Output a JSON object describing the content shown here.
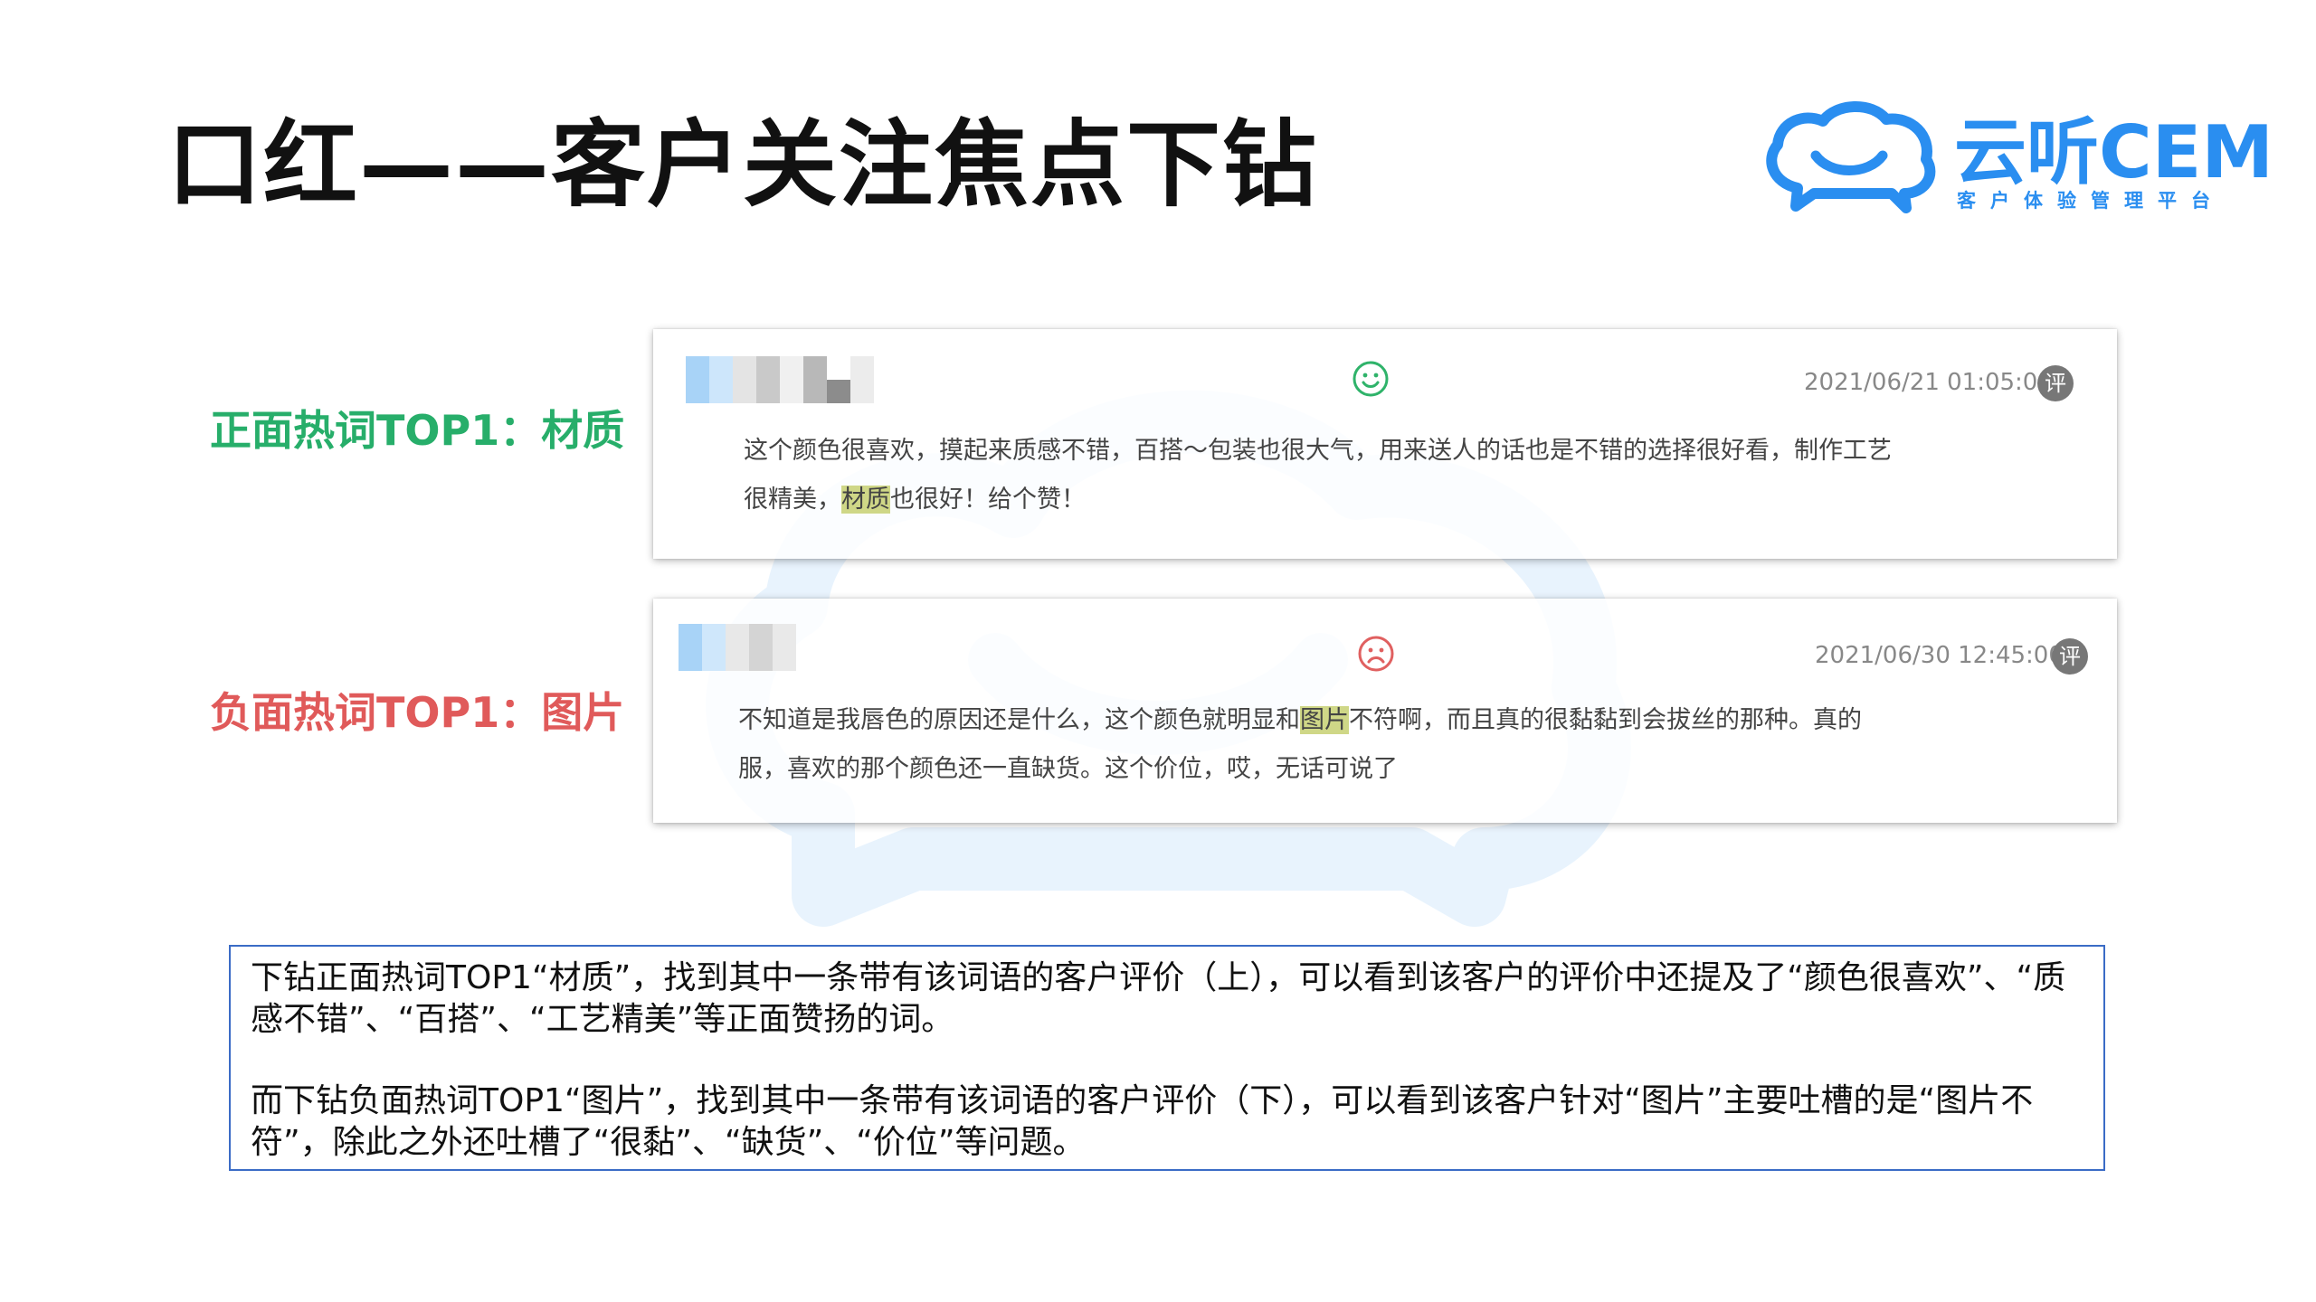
{
  "slide": {
    "title": "口红——客户关注焦点下钻"
  },
  "logo": {
    "name": "云听CEM",
    "subtitle": "客户体验管理平台",
    "icon": "cloud-chat-icon",
    "color": "#2a8ef0"
  },
  "labels": {
    "positive": "正面热词TOP1：材质",
    "negative": "负面热词TOP1：图片"
  },
  "reviews": [
    {
      "sentiment": "positive",
      "icon": "smile-face-icon",
      "timestamp": "2021/06/21 01:05:00",
      "badge": "评",
      "line1": "这个颜色很喜欢，摸起来质感不错，百搭～包装也很大气，用来送人的话也是不错的选择很好看，制作工艺",
      "line2_before": "很精美，",
      "keyword": "材质",
      "line2_after": "也很好！给个赞！"
    },
    {
      "sentiment": "negative",
      "icon": "sad-face-icon",
      "timestamp": "2021/06/30 12:45:00",
      "badge": "评",
      "line1_before": "不知道是我唇色的原因还是什么，这个颜色就明显和",
      "keyword": "图片",
      "line1_after": "不符啊，而且真的很黏黏到会拔丝的那种。真的",
      "line2": "服，喜欢的那个颜色还一直缺货。这个价位，哎，无话可说了"
    }
  ],
  "summary": {
    "paragraph1": "下钻正面热词TOP1“材质”，找到其中一条带有该词语的客户评价（上），可以看到该客户的评价中还提及了“颜色很喜欢”、“质感不错”、“百搭”、“工艺精美”等正面赞扬的词。",
    "paragraph2": "而下钻负面热词TOP1“图片”，找到其中一条带有该词语的客户评价（下），可以看到该客户针对“图片”主要吐槽的是“图片不符”，除此之外还吐槽了“很黏”、“缺货”、“价位”等问题。"
  },
  "colors": {
    "positive": "#27ae6a",
    "negative": "#e05a5a",
    "highlight": "#cfd787",
    "summary_border": "#3b6cc6"
  }
}
